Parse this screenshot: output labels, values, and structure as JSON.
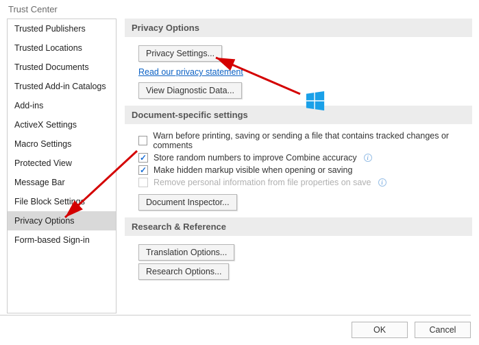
{
  "window": {
    "title": "Trust Center"
  },
  "sidebar": {
    "items": [
      "Trusted Publishers",
      "Trusted Locations",
      "Trusted Documents",
      "Trusted Add-in Catalogs",
      "Add-ins",
      "ActiveX Settings",
      "Macro Settings",
      "Protected View",
      "Message Bar",
      "File Block Settings",
      "Privacy Options",
      "Form-based Sign-in"
    ],
    "selected_index": 10
  },
  "sections": {
    "privacy": {
      "header": "Privacy Options",
      "btn_privacy_settings": "Privacy Settings...",
      "link_privacy_statement": "Read our privacy statement",
      "btn_view_diagnostic": "View Diagnostic Data..."
    },
    "doc": {
      "header": "Document-specific settings",
      "opt_warn": "Warn before printing, saving or sending a file that contains tracked changes or comments",
      "opt_store": "Store random numbers to improve Combine accuracy",
      "opt_markup": "Make hidden markup visible when opening or saving",
      "opt_remove": "Remove personal information from file properties on save",
      "btn_doc_inspector": "Document Inspector..."
    },
    "research": {
      "header": "Research & Reference",
      "btn_translation": "Translation Options...",
      "btn_research": "Research Options..."
    }
  },
  "footer": {
    "ok": "OK",
    "cancel": "Cancel"
  }
}
